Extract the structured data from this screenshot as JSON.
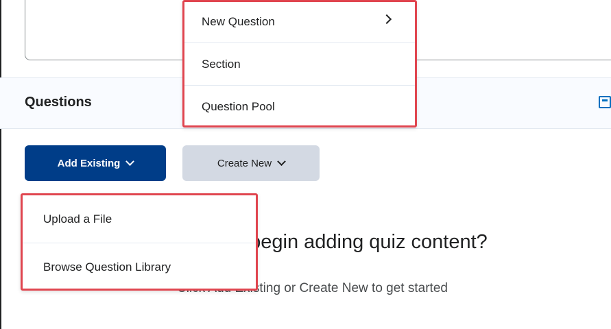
{
  "create_new_menu": {
    "items": [
      {
        "label": "New Question",
        "has_submenu": true,
        "icon": "chevron-right-icon"
      },
      {
        "label": "Section"
      },
      {
        "label": "Question Pool"
      }
    ]
  },
  "questions_section": {
    "title": "Questions"
  },
  "toolbar": {
    "add_existing_label": "Add Existing",
    "create_new_label": "Create New"
  },
  "add_existing_menu": {
    "items": [
      {
        "label": "Upload a File"
      },
      {
        "label": "Browse Question Library"
      }
    ]
  },
  "empty_state": {
    "heading": "Ready to begin adding quiz content?",
    "subtext": "Click Add Existing or Create New to get started"
  },
  "colors": {
    "primary_button": "#003d88",
    "secondary_button": "#d3d9e3",
    "highlight_border": "#e0454f",
    "link_icon": "#006fbf"
  }
}
